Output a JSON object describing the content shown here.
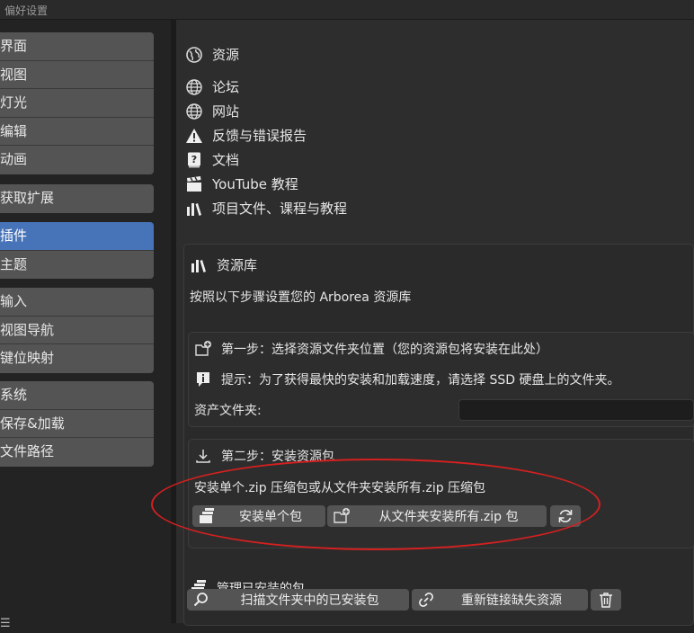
{
  "window": {
    "title": "偏好设置"
  },
  "sidebar": {
    "groups": [
      [
        "界面",
        "视图",
        "灯光",
        "编辑",
        "动画"
      ],
      [
        "获取扩展"
      ],
      [
        "插件",
        "主题"
      ],
      [
        "输入",
        "视图导航",
        "键位映射"
      ],
      [
        "系统",
        "保存&加载",
        "文件路径"
      ]
    ],
    "active": "插件"
  },
  "header": {
    "title": "资源"
  },
  "links": [
    "论坛",
    "网站",
    "反馈与错误报告",
    "文档",
    "YouTube 教程",
    "项目文件、课程与教程"
  ],
  "library": {
    "title": "资源库",
    "description": "按照以下步骤设置您的 Arborea 资源库",
    "step1": {
      "title": "第一步：选择资源文件夹位置（您的资源包将安装在此处）",
      "tip": "提示：为了获得最快的安装和加载速度，请选择 SSD 硬盘上的文件夹。",
      "field_label": "资产文件夹:",
      "field_value": ""
    },
    "step2": {
      "title": "第二步：安装资源包",
      "description": "安装单个.zip 压缩包或从文件夹安装所有.zip 压缩包",
      "install_single": "安装单个包",
      "install_all": "从文件夹安装所有.zip 包"
    },
    "manage": {
      "title": "管理已安装的包",
      "scan": "扫描文件夹中的已安装包",
      "relink": "重新链接缺失资源"
    }
  },
  "colors": {
    "accent": "#4773b8",
    "highlight": "#d42020"
  }
}
